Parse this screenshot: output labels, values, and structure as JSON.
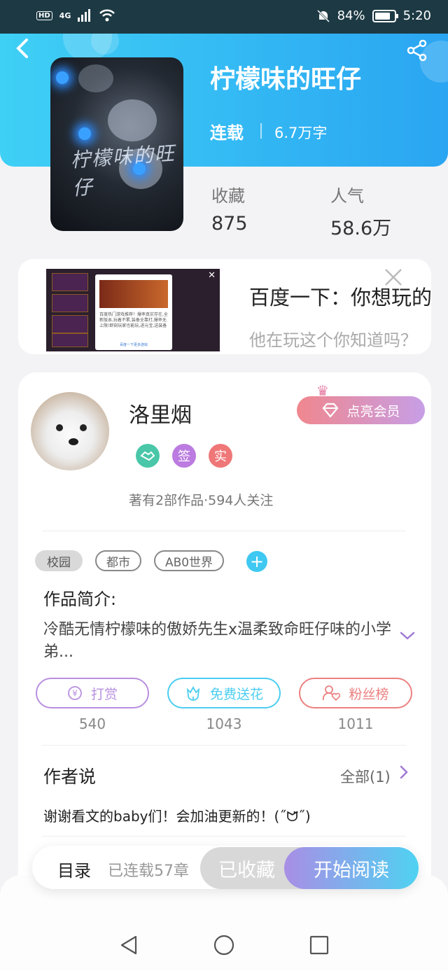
{
  "status_bar": {
    "hd": "HD",
    "network": "4G",
    "battery": "84%",
    "time": "5:20"
  },
  "book": {
    "title": "柠檬味的旺仔",
    "status": "连载",
    "words": "6.7万字",
    "cover_signature": "柠檬味的旺仔",
    "favorites_label": "收藏",
    "favorites_value": "875",
    "popularity_label": "人气",
    "popularity_value": "58.6万"
  },
  "ad": {
    "title": "百度一下：你想玩的",
    "subtitle": "他在玩这个你知道吗？",
    "popup_text": "百度热门游戏推荐！爆率真实存在,全新版本,玩着不累,装备全靠打,爆率无上限!即刻玩家也能玩,进元宝,送装备",
    "popup_link": "百度一下更多游戏"
  },
  "author": {
    "name": "洛里烟",
    "vip_button": "点亮会员",
    "badges": [
      "签",
      "实"
    ],
    "works_info": "著有2部作品·594人关注"
  },
  "tags": [
    "校园",
    "都市",
    "AB0世界"
  ],
  "intro": {
    "title": "作品简介:",
    "text": "冷酷无情柠檬味的傲娇先生x温柔致命旺仔味的小学弟..."
  },
  "actions": [
    {
      "label": "打赏",
      "count": "540",
      "color": "#b88fe0"
    },
    {
      "label": "免费送花",
      "count": "1043",
      "color": "#4ccdf0"
    },
    {
      "label": "粉丝榜",
      "count": "1011",
      "color": "#ec8080"
    }
  ],
  "author_says": {
    "title": "作者说",
    "all_label": "全部(1)",
    "text": "谢谢看文的baby们！会加油更新的！(˝ᗢ̈˝)"
  },
  "bottom_bar": {
    "toc": "目录",
    "chapters": "已连载57章",
    "collected": "已收藏",
    "read": "开始阅读"
  },
  "colors": {
    "accent": "#3fc8f1",
    "vip": "#e98c9d",
    "purple": "#a07ad6"
  }
}
